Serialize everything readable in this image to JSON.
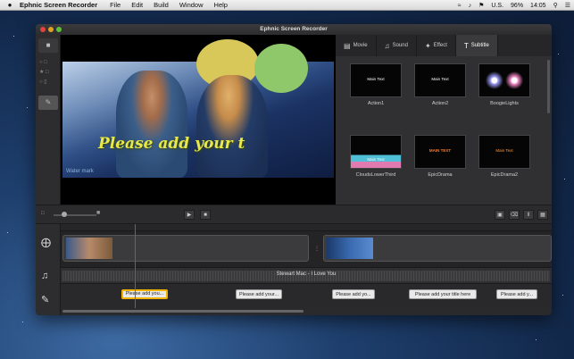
{
  "menubar": {
    "apple": "",
    "app_name": "Ephnic Screen Recorder",
    "menus": [
      "File",
      "Edit",
      "Build",
      "Window",
      "Help"
    ],
    "status": {
      "input": "U.S.",
      "battery": "96%",
      "time": "14:05"
    }
  },
  "window": {
    "title": "Ephnic Screen Recorder"
  },
  "preview": {
    "subtitle_text": "Please add your t",
    "watermark": "Water mark"
  },
  "panel": {
    "tabs": [
      {
        "label": "Movie",
        "icon": "film-icon"
      },
      {
        "label": "Sound",
        "icon": "speaker-icon"
      },
      {
        "label": "Effect",
        "icon": "magic-wand-icon"
      },
      {
        "label": "Subtitle",
        "icon": "text-icon"
      }
    ],
    "active_tab": "Subtitle",
    "templates": [
      {
        "name": "Action1",
        "preview_text": "Main Text"
      },
      {
        "name": "Action2",
        "preview_text": "Main Text"
      },
      {
        "name": "BoogieLights",
        "preview_text": ""
      },
      {
        "name": "CloudsLowerThird",
        "preview_text": "Main Text"
      },
      {
        "name": "EpicDrama",
        "preview_text": "MAIN TEXT"
      },
      {
        "name": "EpicDrama2",
        "preview_text": "Main Text"
      }
    ]
  },
  "timeline": {
    "audio_track_label": "Stewart Mac - I Love You",
    "subtitle_clips": [
      "Please add you...",
      "Please add your...",
      "Please add yo...",
      "Please add your title here",
      "Please add y..."
    ],
    "selected_subtitle": 0
  },
  "colors": {
    "subtitle": "#e9e84a",
    "playhead": "#e23030",
    "selection": "#f0b400"
  }
}
